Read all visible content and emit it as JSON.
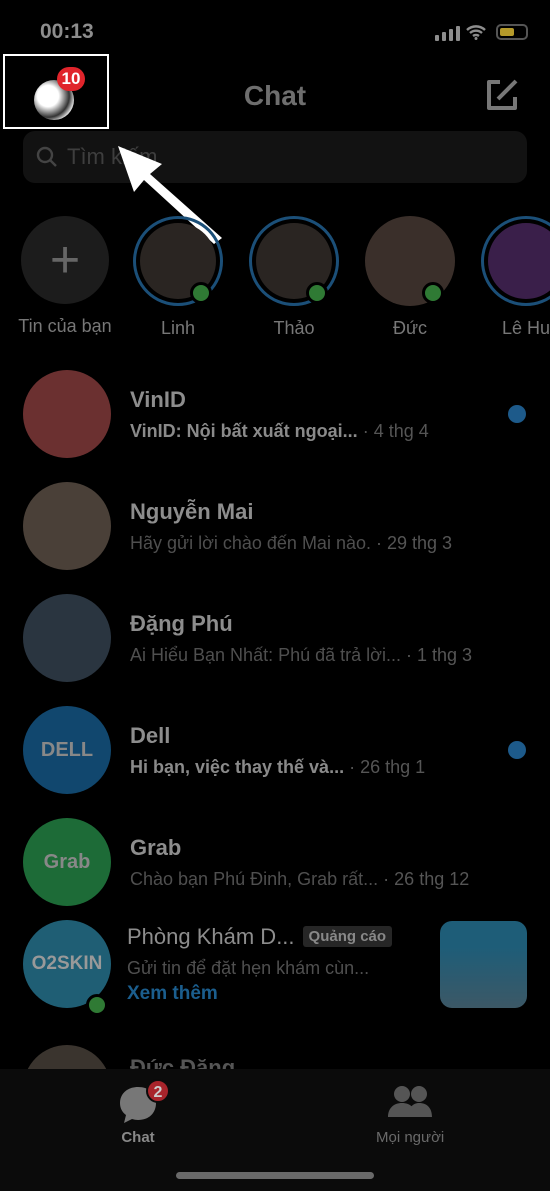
{
  "status": {
    "time": "00:13"
  },
  "header": {
    "title": "Chat",
    "profile_badge": "10"
  },
  "search": {
    "placeholder": "Tìm kiếm"
  },
  "stories": [
    {
      "label": "Tin của bạn"
    },
    {
      "label": "Linh"
    },
    {
      "label": "Thảo"
    },
    {
      "label": "Đức"
    },
    {
      "label": "Lê Hu"
    }
  ],
  "chats": [
    {
      "name": "VinID",
      "message": "VinID: Nội bất xuất ngoại...",
      "time": "· 4 thg 4",
      "unread": true,
      "avatar_color": "#6b3030"
    },
    {
      "name": "Nguyễn Mai",
      "message": "Hãy gửi lời chào đến Mai nào.",
      "time": "· 29 thg 3",
      "unread": false,
      "avatar_color": "#4a4038"
    },
    {
      "name": "Đặng Phú",
      "message": "Ai Hiểu Bạn Nhất: Phú đã trả lời...",
      "time": "· 1 thg 3",
      "unread": false,
      "avatar_color": "#2a3540"
    },
    {
      "name": "Dell",
      "message": "Hi bạn, việc thay thế và...",
      "time": "· 26 thg 1",
      "unread": true,
      "avatar_color": "#11476e",
      "avatar_text": "DELL"
    },
    {
      "name": "Grab",
      "message": "Chào bạn Phú Đinh, Grab rất...",
      "time": "· 26 thg 12",
      "unread": false,
      "avatar_color": "#1d6b37",
      "avatar_text": "Grab"
    }
  ],
  "ad": {
    "name": "Phòng Khám D...",
    "tag": "Quảng cáo",
    "message": "Gửi tin để đặt hẹn khám cùn...",
    "link": "Xem thêm",
    "avatar_text": "O2SKIN"
  },
  "partial_chat": {
    "name": "Đức Đặng"
  },
  "tabs": [
    {
      "label": "Chat",
      "badge": "2"
    },
    {
      "label": "Mọi người"
    }
  ]
}
